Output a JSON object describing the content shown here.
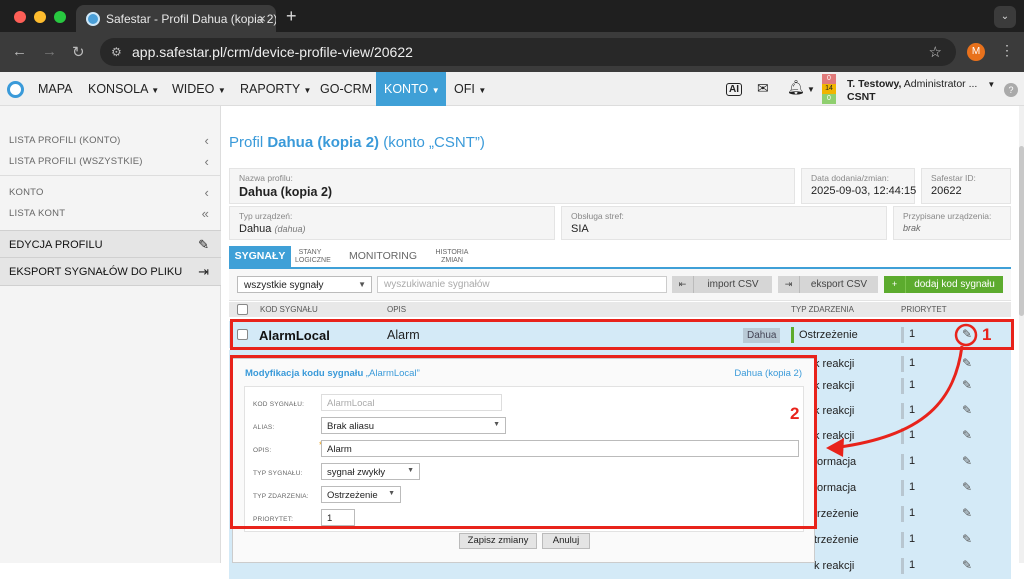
{
  "browser": {
    "tab_title": "Safestar - Profil Dahua (kopia 2)",
    "tab_close": "×",
    "new_tab": "+",
    "url": "app.safestar.pl/crm/device-profile-view/20622",
    "profile_initial": "M"
  },
  "nav": {
    "items": [
      "MAPA",
      "KONSOLA",
      "WIDEO",
      "RAPORTY",
      "GO-CRM",
      "KONTO",
      "OFI"
    ],
    "active": "KONTO",
    "ai_label": "AI",
    "counters": [
      "0",
      "14",
      "0"
    ],
    "counter_colors": [
      "#e07a7a",
      "#f0b400",
      "#8fcf6f"
    ],
    "user_name": "T. Testowy,",
    "user_role": " Administrator ...",
    "user_account": "CSNT",
    "help": "?"
  },
  "sidebar": {
    "items": [
      {
        "label": "LISTA PROFILI (KONTO)",
        "chevron": "‹"
      },
      {
        "label": "LISTA PROFILI (WSZYSTKIE)",
        "chevron": "‹"
      },
      {
        "label": "KONTO",
        "chevron": "‹"
      },
      {
        "label": "LISTA KONT",
        "chevron": "«"
      }
    ],
    "actions": [
      {
        "label": "EDYCJA PROFILU",
        "icon": "✎"
      },
      {
        "label": "EKSPORT SYGNAŁÓW DO PLIKU",
        "icon": "⇥"
      }
    ]
  },
  "profile": {
    "title_prefix": "Profil ",
    "title_name": "Dahua (kopia 2)",
    "title_suffix": " (konto „CSNT”)",
    "name_label": "Nazwa profilu:",
    "name_value": "Dahua (kopia 2)",
    "date_label": "Data dodania/zmian:",
    "date_value": "2025-09-03, 12:44:15",
    "id_label": "Safestar ID:",
    "id_value": "20622",
    "device_type_label": "Typ urządzeń:",
    "device_type_value": "Dahua",
    "device_type_sub": "(dahua)",
    "zones_label": "Obsługa stref:",
    "zones_value": "SIA",
    "assigned_label": "Przypisane urządzenia:",
    "assigned_value": "brak"
  },
  "tabs": [
    {
      "label": "SYGNAŁY"
    },
    {
      "label1": "STANY",
      "label2": "LOGICZNE"
    },
    {
      "label": "MONITORING"
    },
    {
      "label1": "HISTORIA",
      "label2": "ZMIAN"
    }
  ],
  "toolbar": {
    "filter_value": "wszystkie sygnały",
    "search_placeholder": "wyszukiwanie sygnałów",
    "import_label": "import CSV",
    "export_label": "eksport CSV",
    "add_label": "dodaj kod sygnału"
  },
  "table": {
    "headers": {
      "code": "KOD SYGNAŁU",
      "desc": "OPIS",
      "type": "TYP ZDARZENIA",
      "priority": "PRIORYTET"
    },
    "first_row": {
      "code": "AlarmLocal",
      "desc": "Alarm",
      "badge": "Dahua",
      "type": "Ostrzeżenie",
      "priority": "1"
    },
    "rows": [
      {
        "type": "k reakcji",
        "priority": "1"
      },
      {
        "type": "k reakcji",
        "priority": "1"
      },
      {
        "type": "k reakcji",
        "priority": "1"
      },
      {
        "type": "k reakcji",
        "priority": "1"
      },
      {
        "type": "formacja",
        "priority": "1"
      },
      {
        "type": "formacja",
        "priority": "1"
      },
      {
        "type": "trzeżenie",
        "priority": "1"
      },
      {
        "type": "trzeżenie",
        "priority": "1"
      },
      {
        "type": "k reakcji",
        "priority": "1"
      }
    ]
  },
  "annotations": {
    "label1": "1",
    "label2": "2",
    "color": "#e8231b"
  },
  "modal": {
    "title_prefix": "Modyfikacja kodu sygnału ",
    "title_code": "„AlarmLocal”",
    "profile": "Dahua (kopia 2)",
    "code_label": "KOD SYGNAŁU:",
    "code_value": "AlarmLocal",
    "alias_label": "ALIAS:",
    "alias_value": "Brak aliasu",
    "desc_label": "OPIS:",
    "desc_required": "*",
    "desc_value": "Alarm",
    "signal_type_label": "TYP SYGNAŁU:",
    "signal_type_value": "sygnał zwykły",
    "event_type_label": "TYP ZDARZENIA:",
    "event_type_value": "Ostrzeżenie",
    "priority_label": "PRIORYTET:",
    "priority_value": "1",
    "save_label": "Zapisz zmiany",
    "cancel_label": "Anuluj"
  }
}
